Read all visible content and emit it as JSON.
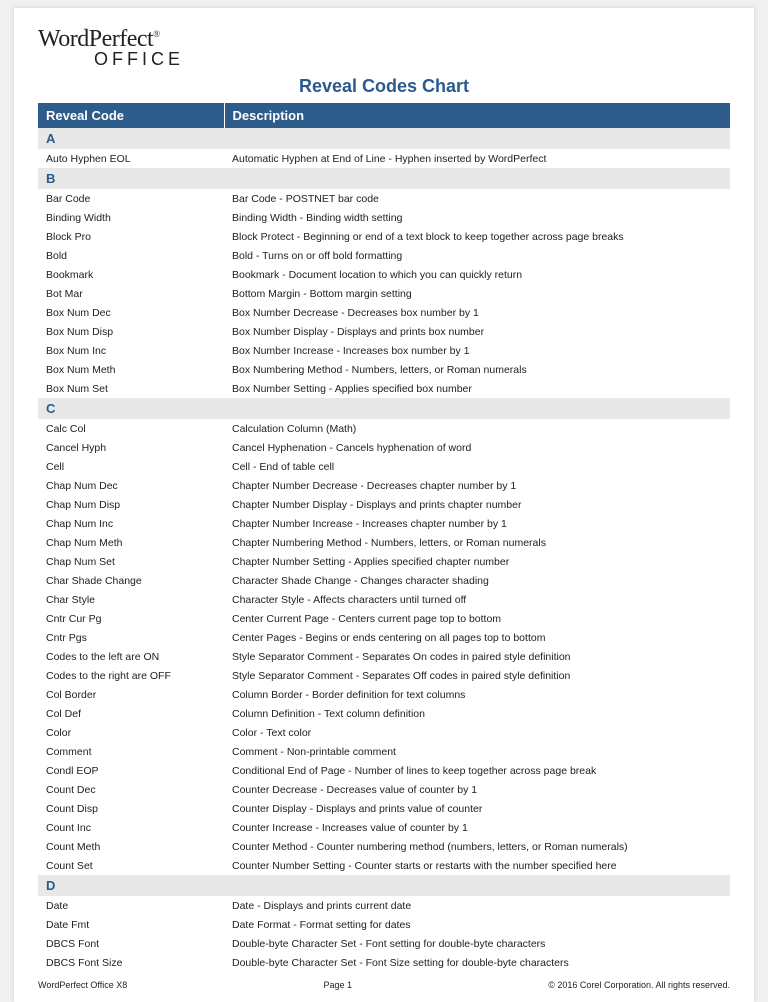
{
  "logo": {
    "brand1": "WordPerfect",
    "reg": "®",
    "brand2": "OFFICE"
  },
  "title": "Reveal Codes Chart",
  "headers": {
    "code": "Reveal Code",
    "desc": "Description"
  },
  "sections": [
    {
      "letter": "A",
      "rows": [
        {
          "code": "Auto Hyphen EOL",
          "desc": "Automatic Hyphen at End of Line - Hyphen inserted by WordPerfect"
        }
      ]
    },
    {
      "letter": "B",
      "rows": [
        {
          "code": "Bar Code",
          "desc": "Bar Code - POSTNET bar code"
        },
        {
          "code": "Binding Width",
          "desc": "Binding Width - Binding width setting"
        },
        {
          "code": "Block Pro",
          "desc": "Block Protect - Beginning or end of a text block to keep together across page breaks"
        },
        {
          "code": "Bold",
          "desc": "Bold - Turns on or off bold formatting"
        },
        {
          "code": "Bookmark",
          "desc": "Bookmark - Document location to which you can quickly return"
        },
        {
          "code": "Bot Mar",
          "desc": "Bottom Margin - Bottom margin setting"
        },
        {
          "code": "Box Num Dec",
          "desc": "Box Number Decrease - Decreases box number by 1"
        },
        {
          "code": "Box Num Disp",
          "desc": "Box Number Display - Displays and prints box number"
        },
        {
          "code": "Box Num Inc",
          "desc": "Box Number Increase - Increases box number by 1"
        },
        {
          "code": "Box Num Meth",
          "desc": "Box Numbering Method - Numbers, letters, or Roman numerals"
        },
        {
          "code": "Box Num Set",
          "desc": "Box Number Setting - Applies specified box number"
        }
      ]
    },
    {
      "letter": "C",
      "rows": [
        {
          "code": "Calc Col",
          "desc": "Calculation Column (Math)"
        },
        {
          "code": "Cancel Hyph",
          "desc": "Cancel Hyphenation - Cancels hyphenation of word"
        },
        {
          "code": "Cell",
          "desc": "Cell - End of table cell"
        },
        {
          "code": "Chap Num Dec",
          "desc": "Chapter Number Decrease - Decreases chapter number by 1"
        },
        {
          "code": "Chap Num Disp",
          "desc": "Chapter Number Display - Displays and prints chapter number"
        },
        {
          "code": "Chap Num Inc",
          "desc": "Chapter Number Increase - Increases chapter number by 1"
        },
        {
          "code": "Chap Num Meth",
          "desc": "Chapter Numbering Method - Numbers, letters, or Roman numerals"
        },
        {
          "code": "Chap Num Set",
          "desc": "Chapter Number Setting - Applies specified chapter number"
        },
        {
          "code": "Char Shade Change",
          "desc": "Character Shade Change - Changes character shading"
        },
        {
          "code": "Char Style",
          "desc": "Character Style - Affects characters until turned off"
        },
        {
          "code": "Cntr Cur Pg",
          "desc": "Center Current Page - Centers current page top to bottom"
        },
        {
          "code": "Cntr Pgs",
          "desc": "Center Pages - Begins or ends centering on all pages top to bottom"
        },
        {
          "code": "Codes to the left are ON",
          "desc": "Style Separator Comment - Separates On codes in paired style definition"
        },
        {
          "code": "Codes to the right are OFF",
          "desc": "Style Separator Comment - Separates Off codes in paired style definition"
        },
        {
          "code": "Col Border",
          "desc": "Column Border - Border definition for text columns"
        },
        {
          "code": "Col Def",
          "desc": "Column Definition - Text column definition"
        },
        {
          "code": "Color",
          "desc": "Color - Text color"
        },
        {
          "code": "Comment",
          "desc": "Comment - Non-printable comment"
        },
        {
          "code": "Condl EOP",
          "desc": "Conditional End of Page - Number of lines to keep together across page break"
        },
        {
          "code": "Count Dec",
          "desc": "Counter Decrease - Decreases value of counter by 1"
        },
        {
          "code": "Count Disp",
          "desc": "Counter Display - Displays and prints value of counter"
        },
        {
          "code": "Count Inc",
          "desc": "Counter Increase - Increases value of counter by 1"
        },
        {
          "code": "Count Meth",
          "desc": "Counter Method - Counter numbering method (numbers, letters, or Roman numerals)"
        },
        {
          "code": "Count Set",
          "desc": "Counter Number Setting - Counter starts or restarts with the number specified here"
        }
      ]
    },
    {
      "letter": "D",
      "rows": [
        {
          "code": "Date",
          "desc": "Date - Displays and prints current date"
        },
        {
          "code": "Date Fmt",
          "desc": "Date Format - Format setting for dates"
        },
        {
          "code": "DBCS Font",
          "desc": "Double-byte Character Set - Font setting for double-byte characters"
        },
        {
          "code": "DBCS Font Size",
          "desc": "Double-byte Character Set - Font Size setting for double-byte characters"
        }
      ]
    }
  ],
  "footer": {
    "left": "WordPerfect Office X8",
    "center": "Page 1",
    "right": "© 2016 Corel Corporation. All rights reserved."
  }
}
